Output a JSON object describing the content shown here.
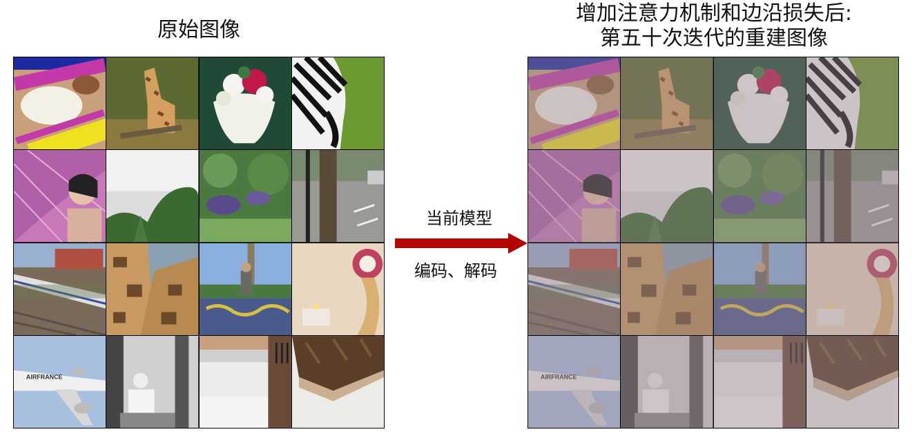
{
  "left_title": "原始图像",
  "right_title": {
    "line1": "增加注意力机制和边沿损失后:",
    "line2": "第五十次迭代的重建图像"
  },
  "arrow": {
    "top_label": "当前模型",
    "bottom_label": "编码、解码",
    "color": "#b30000"
  },
  "tiles": [
    {
      "name": "food-box",
      "text": ""
    },
    {
      "name": "giraffe",
      "text": ""
    },
    {
      "name": "flower-vase",
      "text": ""
    },
    {
      "name": "zebra",
      "text": ""
    },
    {
      "name": "umbrella-woman",
      "text": ""
    },
    {
      "name": "trees-sky",
      "text": ""
    },
    {
      "name": "jungle-animals",
      "text": ""
    },
    {
      "name": "street-tree",
      "text": ""
    },
    {
      "name": "train",
      "text": ""
    },
    {
      "name": "giraffes-closeup",
      "text": ""
    },
    {
      "name": "graffiti-skater",
      "text": ""
    },
    {
      "name": "clock-candle",
      "text": ""
    },
    {
      "name": "airplane",
      "text": "AIRFRANCE"
    },
    {
      "name": "old-photo-man",
      "text": ""
    },
    {
      "name": "kitchen-stove",
      "text": ""
    },
    {
      "name": "cake-slice",
      "text": ""
    }
  ]
}
